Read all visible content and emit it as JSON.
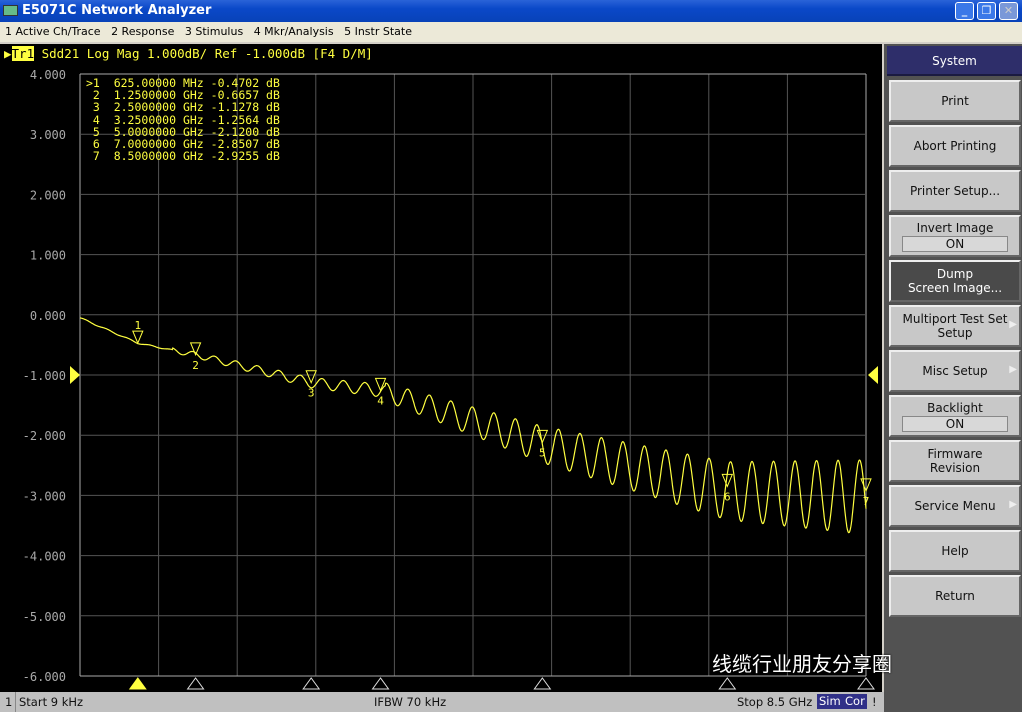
{
  "window": {
    "title": "E5071C Network Analyzer",
    "controls": [
      "minimize",
      "restore",
      "close"
    ]
  },
  "menu": [
    "1 Active Ch/Trace",
    "2 Response",
    "3 Stimulus",
    "4 Mkr/Analysis",
    "5 Instr State"
  ],
  "trace_header": {
    "trace": "Tr1",
    "text": " Sdd21 Log Mag 1.000dB/ Ref -1.000dB [F4 D/M]"
  },
  "chart_data": {
    "type": "line",
    "x_range_ghz": [
      9e-06,
      8.5
    ],
    "ylim": [
      -6,
      4
    ],
    "y_ticks": [
      "4.000",
      "3.000",
      "2.000",
      "1.000",
      "0.000",
      "-1.000",
      "-2.000",
      "-3.000",
      "-4.000",
      "-5.000",
      "-6.000"
    ],
    "reference_level": -1.0,
    "grid": true,
    "series": [
      {
        "name": "Sdd21",
        "color": "#ffff40",
        "x_ghz": [
          0.0,
          0.625,
          1.25,
          2.5,
          3.25,
          5.0,
          7.0,
          8.5
        ],
        "y_db": [
          -0.05,
          -0.4702,
          -0.6657,
          -1.1278,
          -1.2564,
          -2.12,
          -2.8507,
          -2.9255
        ]
      }
    ],
    "markers": [
      {
        "id": "1",
        "active": true,
        "freq": "625.00000 MHz",
        "value": "-0.4702 dB",
        "x_ghz": 0.625,
        "y_db": -0.4702
      },
      {
        "id": "2",
        "freq": "1.2500000 GHz",
        "value": "-0.6657 dB",
        "x_ghz": 1.25,
        "y_db": -0.6657
      },
      {
        "id": "3",
        "freq": "2.5000000 GHz",
        "value": "-1.1278 dB",
        "x_ghz": 2.5,
        "y_db": -1.1278
      },
      {
        "id": "4",
        "freq": "3.2500000 GHz",
        "value": "-1.2564 dB",
        "x_ghz": 3.25,
        "y_db": -1.2564
      },
      {
        "id": "5",
        "freq": "5.0000000 GHz",
        "value": "-2.1200 dB",
        "x_ghz": 5.0,
        "y_db": -2.12
      },
      {
        "id": "6",
        "freq": "7.0000000 GHz",
        "value": "-2.8507 dB",
        "x_ghz": 7.0,
        "y_db": -2.8507
      },
      {
        "id": "7",
        "freq": "8.5000000 GHz",
        "value": "-2.9255 dB",
        "x_ghz": 8.5,
        "y_db": -2.9255
      }
    ]
  },
  "softkeys": {
    "header": "System",
    "buttons": [
      {
        "label": "Print"
      },
      {
        "label": "Abort Printing"
      },
      {
        "label": "Printer Setup..."
      },
      {
        "label": "Invert Image",
        "value": "ON"
      },
      {
        "label": "Dump",
        "label2": "Screen Image...",
        "selected": true
      },
      {
        "label": "Multiport Test Set",
        "label2": "Setup",
        "submenu": true
      },
      {
        "label": "Misc Setup",
        "submenu": true
      },
      {
        "label": "Backlight",
        "value": "ON"
      },
      {
        "label": "Firmware",
        "label2": "Revision"
      },
      {
        "label": "Service Menu",
        "submenu": true
      },
      {
        "label": "Help"
      },
      {
        "label": "Return"
      }
    ]
  },
  "status": {
    "channel": "1",
    "start": "Start 9 kHz",
    "ifbw": "IFBW 70 kHz",
    "stop": "Stop 8.5 GHz",
    "sim": "Sim",
    "cor": "Cor",
    "flag": "!"
  },
  "watermark": "线缆行业朋友分享圈"
}
